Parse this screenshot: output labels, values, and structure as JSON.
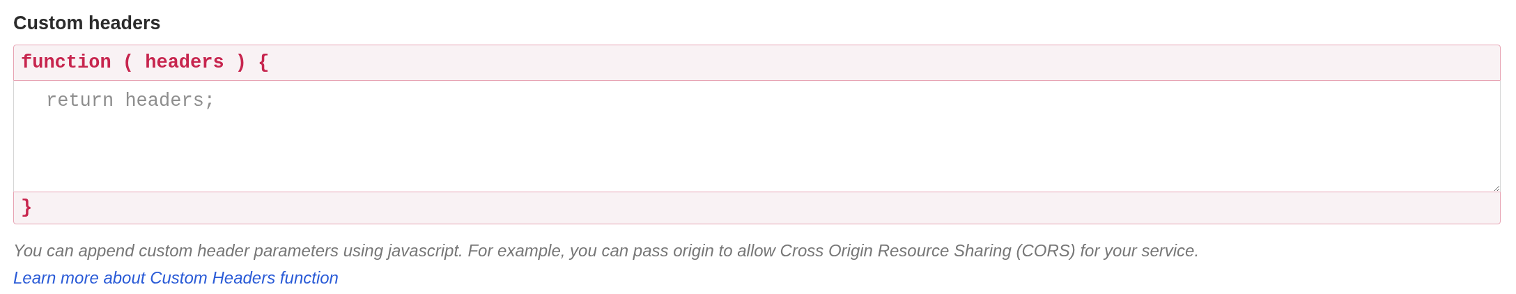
{
  "section": {
    "title": "Custom headers"
  },
  "editor": {
    "header": "function ( headers ) {",
    "placeholder": "return headers;",
    "footer": "}"
  },
  "help": {
    "text": "You can append custom header parameters using javascript. For example, you can pass origin to allow Cross Origin Resource Sharing (CORS) for your service.",
    "link": "Learn more about Custom Headers function"
  }
}
